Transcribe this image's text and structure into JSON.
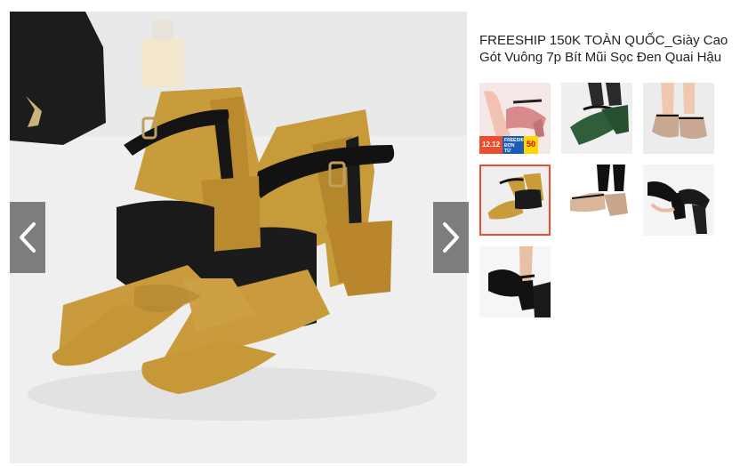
{
  "product": {
    "title": "FREESHIP 150K TOÀN QUỐC_Giày Cao Gót Vuông 7p Bít Mũi Sọc Đen Quai Hậu"
  },
  "gallery": {
    "main_image_alt": "mustard suede pointed-toe block heel shoes",
    "prev_icon": "chevron-left-icon",
    "next_icon": "chevron-right-icon",
    "selected_index": 3,
    "thumbnails": [
      {
        "name": "pink-heels-promo",
        "badge": {
          "a": "12.12",
          "b": "FREESHIP ĐƠN TỪ",
          "c": "50"
        }
      },
      {
        "name": "green-heels"
      },
      {
        "name": "beige-heels"
      },
      {
        "name": "mustard-heels"
      },
      {
        "name": "nude-heels-on-feet"
      },
      {
        "name": "black-heels-pair"
      },
      {
        "name": "black-heels-on-feet"
      }
    ]
  },
  "colors": {
    "accent": "#ee4d2d",
    "arrow_bg": "#646464"
  }
}
